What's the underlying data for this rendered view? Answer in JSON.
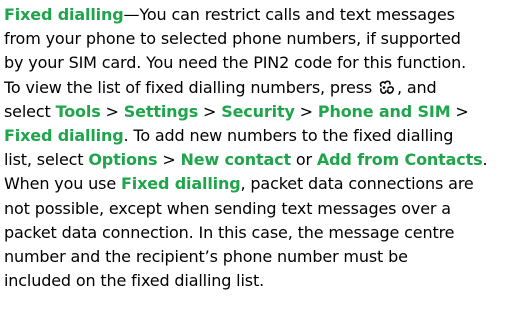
{
  "accent_color": "#1fa54b",
  "icons": {
    "menu_key": "menu-key-icon"
  },
  "doc": {
    "title": "Fixed dialling",
    "t1": "—You can restrict calls and text messages",
    "t2": "from your phone to selected phone numbers, if supported",
    "t3": "by your SIM card. You need the PIN2 code for this function.",
    "t4": "To view the list of fixed dialling numbers, press ",
    "t5": ", and",
    "t6": "select ",
    "tools": "Tools",
    "sep": " > ",
    "settings": "Settings",
    "security": "Security",
    "phone_sim": "Phone and SIM",
    "fixed_dialling_menu": "Fixed dialling",
    "t7": ". To add new numbers to the fixed dialling",
    "t8": "list, select ",
    "options": "Options",
    "new_contact": "New contact",
    "or": " or ",
    "add_from_contacts": "Add from Contacts",
    "period": ".",
    "t9": "When you use ",
    "fixed_dialling_term": "Fixed dialling",
    "t10": ", packet data connections are",
    "t11": "not possible, except when sending text messages over a",
    "t12": "packet data connection. In this case, the message centre",
    "t13": "number and the recipient’s phone number must be",
    "t14": "included on the fixed dialling list."
  }
}
